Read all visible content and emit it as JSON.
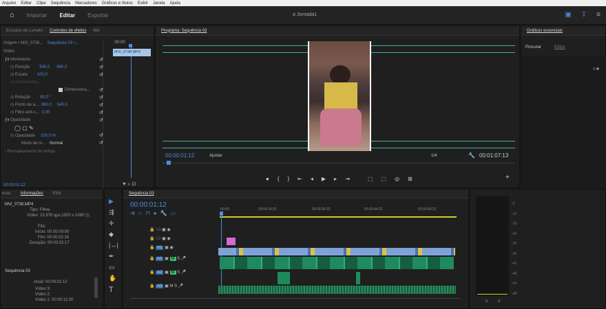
{
  "menu": [
    "Arquivo",
    "Editar",
    "Clipe",
    "Sequência",
    "Marcadores",
    "Gráficos e títulos",
    "Exibir",
    "Janela",
    "Ajuda"
  ],
  "workspaces": {
    "importar": "Importar",
    "editar": "Editar",
    "exportar": "Exportar"
  },
  "project_title": "a Jornada1",
  "effects": {
    "tabs": [
      "Escopos do Lumetri",
      "Controles de efeitos",
      "Mix"
    ],
    "source": "Origem • MVI_0738...",
    "seq": "Sequência 03 •...",
    "clipname": "MVI_0738.MP4",
    "time_start": ":00:00",
    "section": "Vídeo",
    "motion": "Movimento",
    "pos": "Posição",
    "pos_x": "540,0",
    "pos_y": "960,0",
    "scale": "Escala",
    "scale_v": "100,0",
    "scalew": "Dimensiona...",
    "dims": "Dimensiona...",
    "rot": "Rotação",
    "rot_v": "90,0 °",
    "anchor": "Ponto de a...",
    "anc_x": "960,0",
    "anc_y": "540,0",
    "filter": "Filtro anti-c...",
    "filter_v": "0,00",
    "opacity": "Opacidade",
    "op": "Opacidade",
    "op_v": "100,0 %",
    "blend": "Modo de m...",
    "blend_v": "Normal",
    "remap": "Remapeamento de tempo",
    "timecode": "00:00:01:12"
  },
  "program": {
    "title": "Programa: Sequência 03",
    "timecode": "00:00:01:12",
    "fit": "Ajustar",
    "ratio": "1/4",
    "duration": "00:01:07:13"
  },
  "right": {
    "title": "Gráficos essenciais",
    "browse": "Procurar",
    "edit": "Editar"
  },
  "info": {
    "tabs": [
      "ecas",
      "Informações",
      "Efeit"
    ],
    "clip": "MVI_0738.MP4",
    "type": "Tipo: Filme",
    "video": "Vídeo: 23,976 qps,1920 x 1080 (1,",
    "fita": "Fita:",
    "inicio": "Início: 00:00:00:00",
    "fim": "Fim: 00:00:02:16",
    "dur": "Duração: 00:00:02:17",
    "seq": "Sequência 03",
    "atual": "Atual: 00:00:01:12",
    "v3": "Vídeo 3:",
    "v2": "Vídeo 2:",
    "v1": "Vídeo 1: 00:00:11:00"
  },
  "timeline": {
    "title": "Sequência 03",
    "timecode": "00:00:01:12",
    "ticks": [
      ":00:00",
      "00:00:14:23",
      "00:00:29:23",
      "00:00:44:22",
      "00:00:59:22"
    ],
    "tracks": [
      "V3",
      "V2",
      "V1",
      "A1",
      "A2",
      "A3"
    ]
  },
  "meters": [
    "-6",
    "-12",
    "-18",
    "-24",
    "-30",
    "-36",
    "-42",
    "-48",
    "-54",
    "-dB"
  ],
  "meter_lr": [
    "S",
    "S"
  ]
}
